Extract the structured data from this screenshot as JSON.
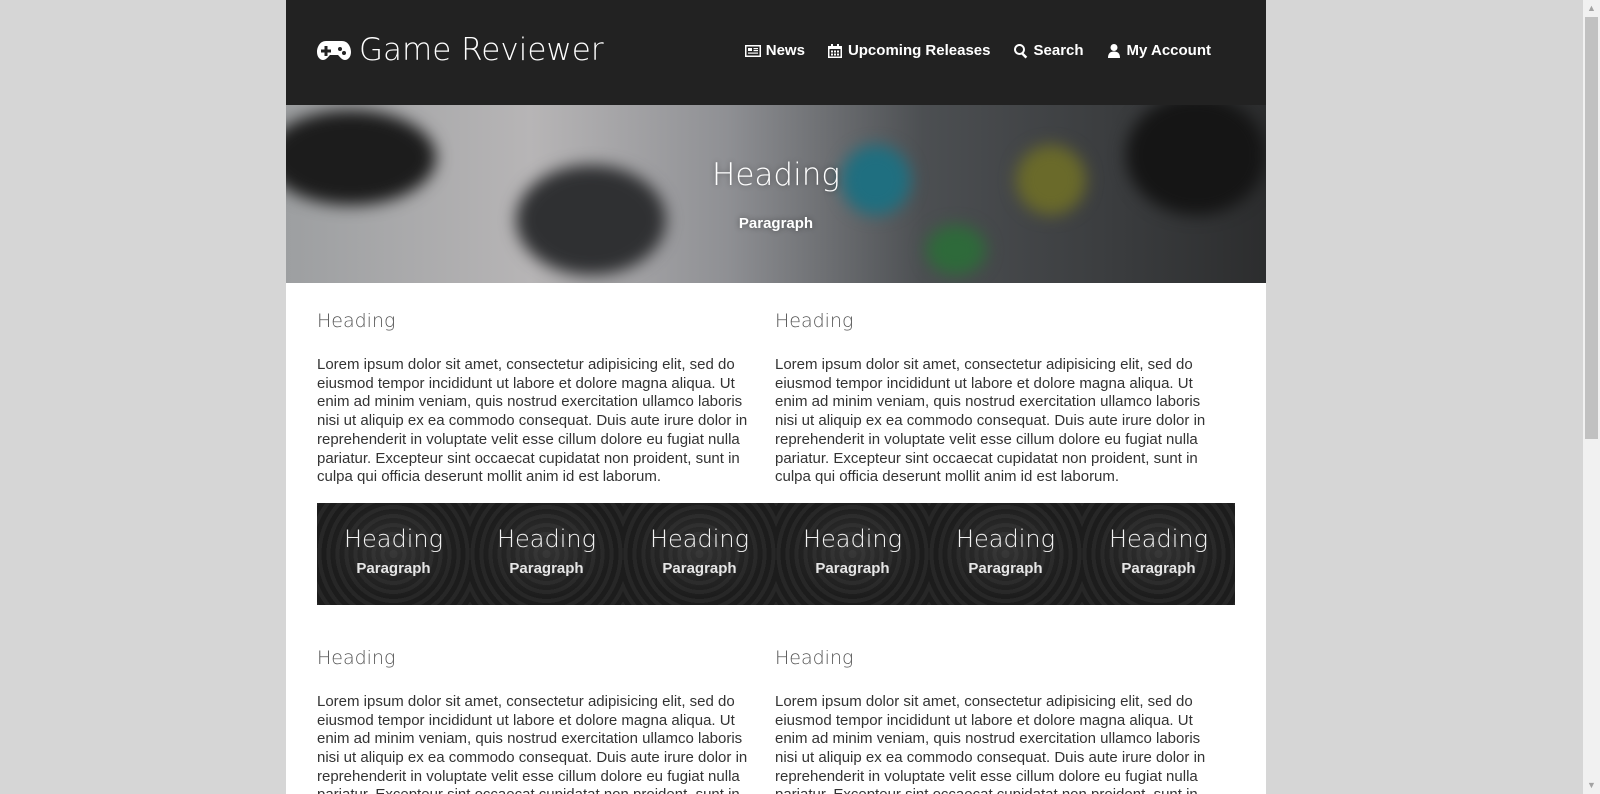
{
  "header": {
    "brand": "Game Reviewer",
    "nav": [
      {
        "label": "News",
        "icon": "newspaper-icon"
      },
      {
        "label": "Upcoming Releases",
        "icon": "calendar-icon"
      },
      {
        "label": "Search",
        "icon": "search-icon"
      },
      {
        "label": "My Account",
        "icon": "user-icon"
      }
    ]
  },
  "hero": {
    "title": "Heading",
    "subtitle": "Paragraph"
  },
  "section1": [
    {
      "heading": "Heading",
      "text": "Lorem ipsum dolor sit amet, consectetur adipisicing elit, sed do eiusmod tempor incididunt ut labore et dolore magna aliqua. Ut enim ad minim veniam, quis nostrud exercitation ullamco laboris nisi ut aliquip ex ea commodo consequat. Duis aute irure dolor in reprehenderit in voluptate velit esse cillum dolore eu fugiat nulla pariatur. Excepteur sint occaecat cupidatat non proident, sunt in culpa qui officia deserunt mollit anim id est laborum."
    },
    {
      "heading": "Heading",
      "text": "Lorem ipsum dolor sit amet, consectetur adipisicing elit, sed do eiusmod tempor incididunt ut labore et dolore magna aliqua. Ut enim ad minim veniam, quis nostrud exercitation ullamco laboris nisi ut aliquip ex ea commodo consequat. Duis aute irure dolor in reprehenderit in voluptate velit esse cillum dolore eu fugiat nulla pariatur. Excepteur sint occaecat cupidatat non proident, sunt in culpa qui officia deserunt mollit anim id est laborum."
    }
  ],
  "tiles": [
    {
      "title": "Heading",
      "subtitle": "Paragraph"
    },
    {
      "title": "Heading",
      "subtitle": "Paragraph"
    },
    {
      "title": "Heading",
      "subtitle": "Paragraph"
    },
    {
      "title": "Heading",
      "subtitle": "Paragraph"
    },
    {
      "title": "Heading",
      "subtitle": "Paragraph"
    },
    {
      "title": "Heading",
      "subtitle": "Paragraph"
    }
  ],
  "section2": [
    {
      "heading": "Heading",
      "text": "Lorem ipsum dolor sit amet, consectetur adipisicing elit, sed do eiusmod tempor incididunt ut labore et dolore magna aliqua. Ut enim ad minim veniam, quis nostrud exercitation ullamco laboris nisi ut aliquip ex ea commodo consequat. Duis aute irure dolor in reprehenderit in voluptate velit esse cillum dolore eu fugiat nulla pariatur. Excepteur sint occaecat cupidatat non proident, sunt in culpa qui officia deserunt mollit anim id est laborum."
    },
    {
      "heading": "Heading",
      "text": "Lorem ipsum dolor sit amet, consectetur adipisicing elit, sed do eiusmod tempor incididunt ut labore et dolore magna aliqua. Ut enim ad minim veniam, quis nostrud exercitation ullamco laboris nisi ut aliquip ex ea commodo consequat. Duis aute irure dolor in reprehenderit in voluptate velit esse cillum dolore eu fugiat nulla pariatur. Excepteur sint occaecat cupidatat non proident, sunt in culpa qui officia deserunt mollit anim id est laborum."
    }
  ],
  "colors": {
    "page_bg": "#d6d6d6",
    "navbar_bg": "#222222",
    "content_bg": "#ffffff",
    "tile_strip_bg": "#262626"
  }
}
